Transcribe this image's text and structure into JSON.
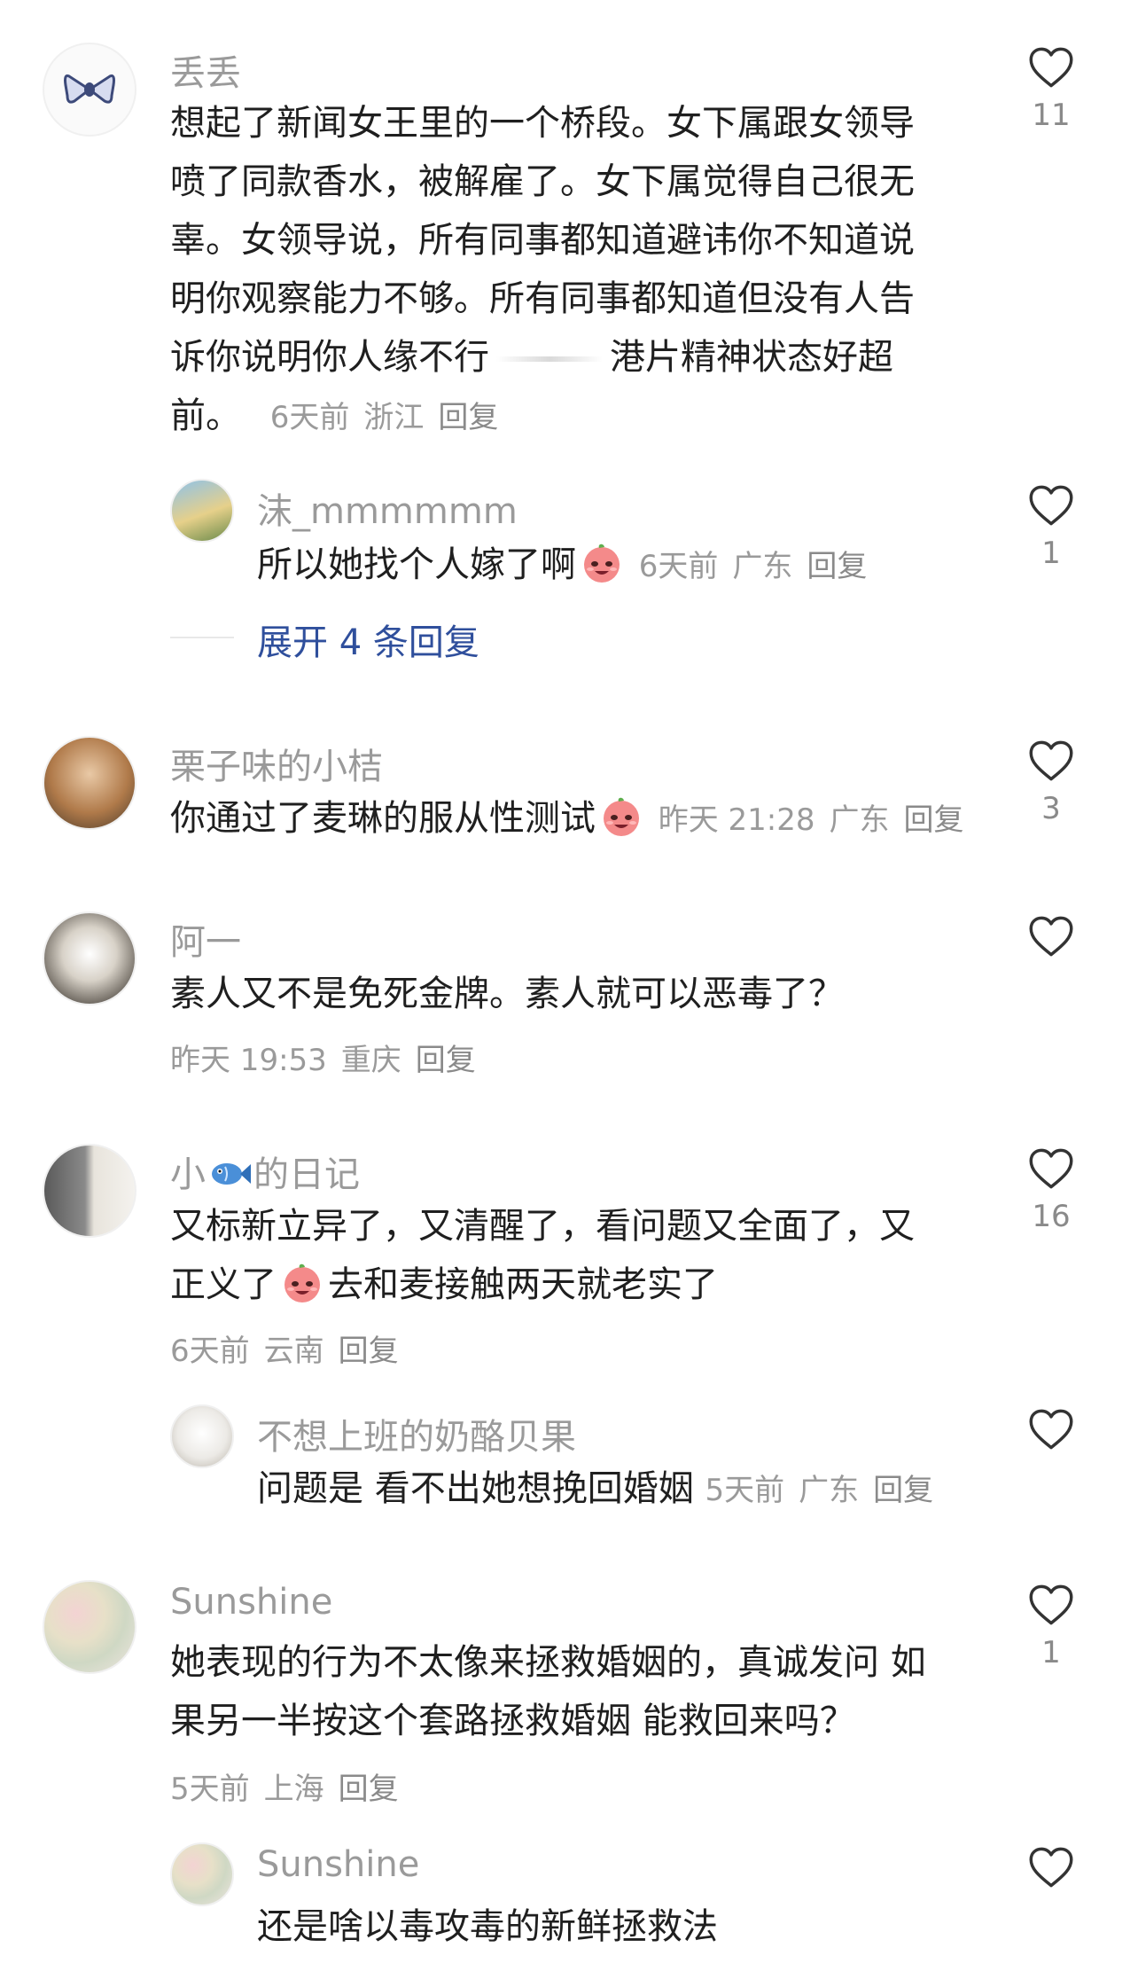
{
  "comments": [
    {
      "name": "丢丢",
      "text_l1": "想起了新闻女王里的一个桥段。女下属跟女领导",
      "text_l2": "喷了同款香水，被解雇了。女下属觉得自己很无",
      "text_l3": "辜。女领导说，所有同事都知道避讳你不知道说",
      "text_l4": "明你观察能力不够。所有同事都知道但没有人告",
      "text_l5a": "诉你说明你人缘不行",
      "text_l5b": "港片精神状态好超",
      "text_l6": "前。",
      "time": "6天前",
      "location": "浙江",
      "reply": "回复",
      "likes": "11",
      "avatar_icon": "bow-icon"
    },
    {
      "name": "沫_mmmmmm",
      "text": "所以她找个人嫁了啊",
      "time": "6天前",
      "location": "广东",
      "reply": "回复",
      "likes": "1",
      "expand": "展开 4 条回复"
    },
    {
      "name": "栗子味的小桔",
      "text": "你通过了麦琳的服从性测试",
      "time": "昨天 21:28",
      "location": "广东",
      "reply": "回复",
      "likes": "3"
    },
    {
      "name": "阿一",
      "text": "素人又不是免死金牌。素人就可以恶毒了？",
      "time": "昨天 19:53",
      "location": "重庆",
      "reply": "回复",
      "likes": ""
    },
    {
      "name_a": "小",
      "name_b": "的日记",
      "text_l1": "又标新立异了，又清醒了，看问题又全面了，又",
      "text_l2a": "正义了",
      "text_l2b": "去和麦接触两天就老实了",
      "time": "6天前",
      "location": "云南",
      "reply": "回复",
      "likes": "16"
    },
    {
      "name": "不想上班的奶酪贝果",
      "text": "问题是 看不出她想挽回婚姻",
      "time": "5天前",
      "location": "广东",
      "reply": "回复",
      "likes": ""
    },
    {
      "name": "Sunshine",
      "text_l1": "她表现的行为不太像来拯救婚姻的，真诚发问  如",
      "text_l2": "果另一半按这个套路拯救婚姻 能救回来吗？",
      "time": "5天前",
      "location": "上海",
      "reply": "回复",
      "likes": "1"
    },
    {
      "name": "Sunshine",
      "text": "还是啥以毒攻毒的新鲜拯救法",
      "likes": ""
    }
  ],
  "colors": {
    "text": "#1f1f1f",
    "muted": "#9a9a9a",
    "link": "#2f4f9c"
  }
}
